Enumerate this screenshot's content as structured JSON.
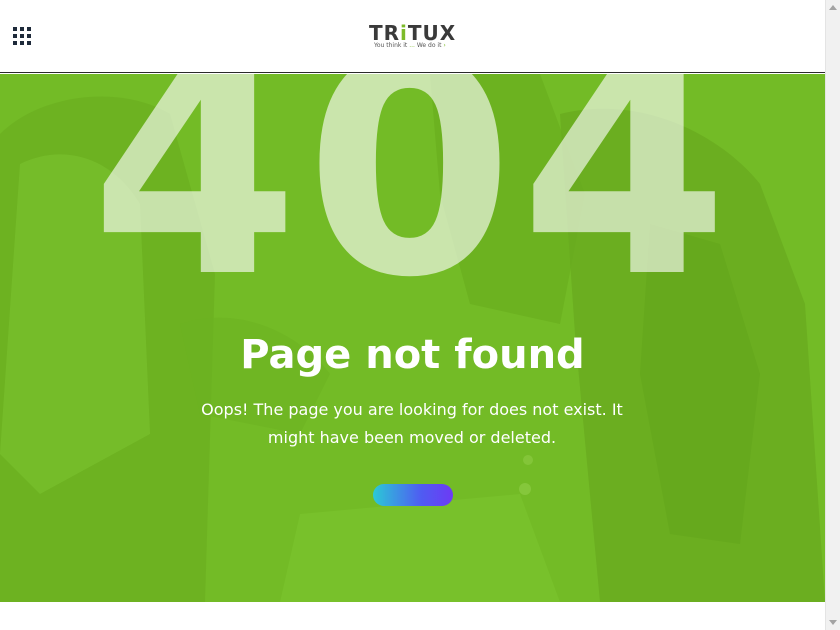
{
  "header": {
    "menu_icon": "grid-menu-icon",
    "logo": {
      "text": "TRITUX",
      "tagline": "You think it ... We do it",
      "accent_color": "#7dbb2a"
    }
  },
  "hero": {
    "background_color": "#73bb26",
    "code": "404",
    "title": "Page not found",
    "message": "Oops! The page you are looking for does not exist. It might have been moved or deleted.",
    "button": {
      "label": "",
      "gradient": [
        "#2bc9d6",
        "#4f5cf2",
        "#6d3af5"
      ]
    }
  }
}
